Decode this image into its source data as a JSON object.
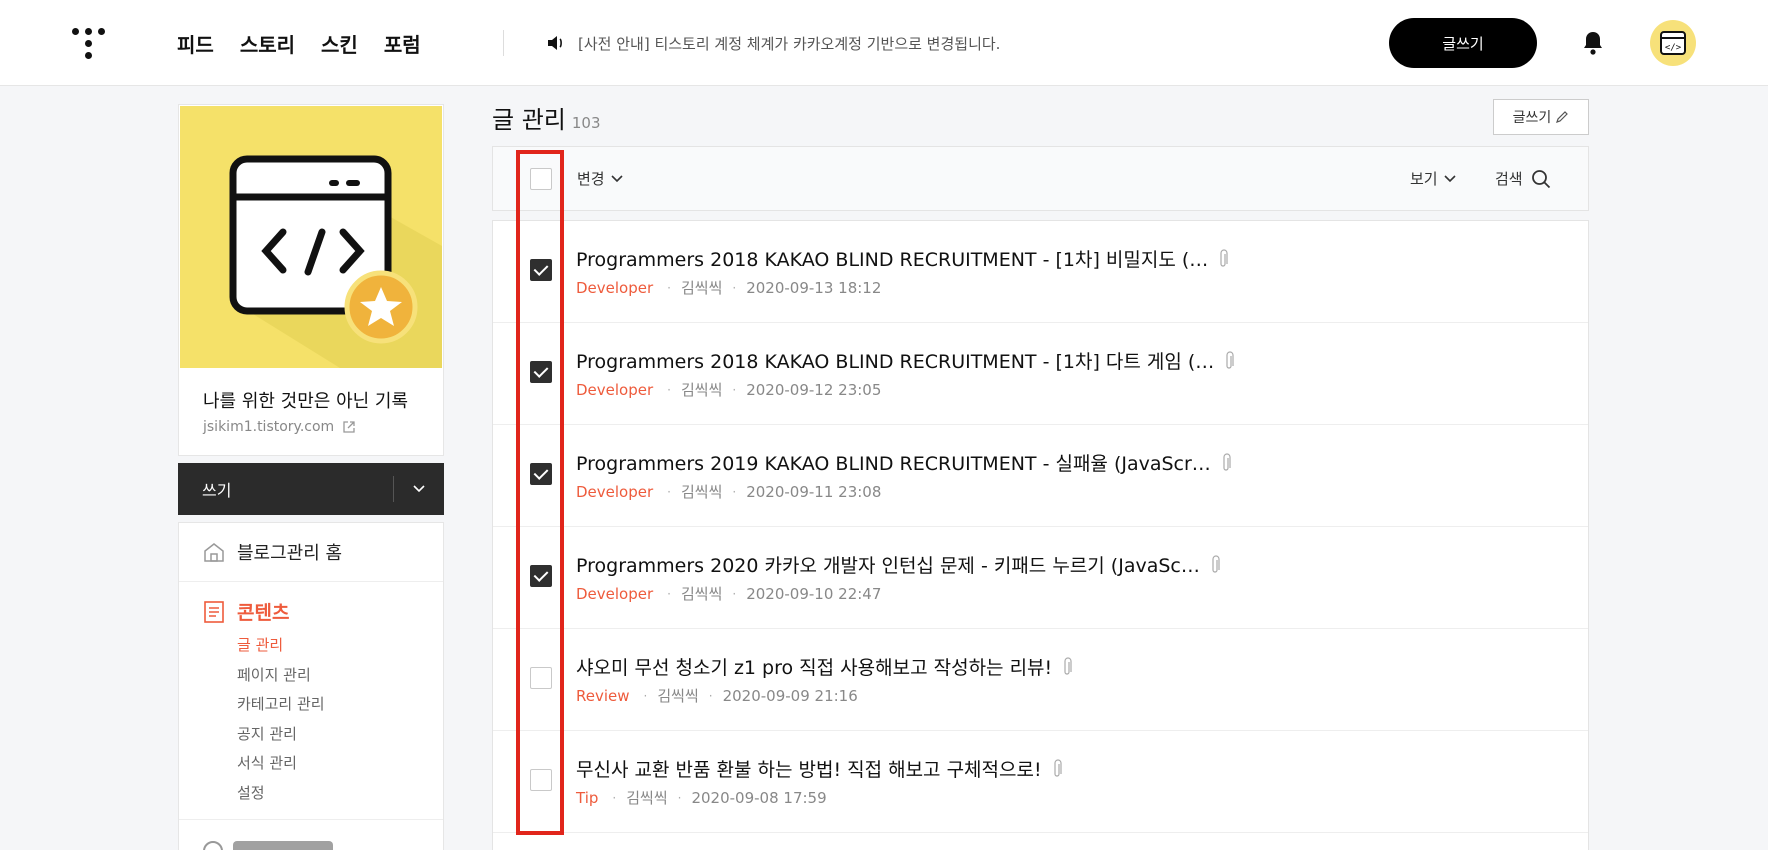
{
  "header": {
    "nav": [
      "피드",
      "스토리",
      "스킨",
      "포럼"
    ],
    "notice": "[사전 안내] 티스토리 계정 체계가 카카오계정 기반으로 변경됩니다.",
    "write_button": "글쓰기"
  },
  "sidebar": {
    "blog_name": "나를 위한 것만은 아닌 기록",
    "blog_url": "jsikim1.tistory.com",
    "write_label": "쓰기",
    "home_label": "블로그관리 홈",
    "content_label": "콘텐츠",
    "submenu": [
      "글 관리",
      "페이지 관리",
      "카테고리 관리",
      "공지 관리",
      "서식 관리",
      "설정"
    ]
  },
  "main": {
    "title": "글 관리",
    "count": "103",
    "write_small": "글쓰기",
    "toolbar": {
      "change": "변경",
      "view": "보기",
      "search": "검색"
    },
    "posts": [
      {
        "title": "Programmers 2018 KAKAO BLIND RECRUITMENT - [1차] 비밀지도 (…",
        "category": "Developer",
        "author": "김씩씩",
        "date": "2020-09-13 18:12",
        "checked": true
      },
      {
        "title": "Programmers 2018 KAKAO BLIND RECRUITMENT - [1차] 다트 게임 (…",
        "category": "Developer",
        "author": "김씩씩",
        "date": "2020-09-12 23:05",
        "checked": true
      },
      {
        "title": "Programmers 2019 KAKAO BLIND RECRUITMENT - 실패율 (JavaScr…",
        "category": "Developer",
        "author": "김씩씩",
        "date": "2020-09-11 23:08",
        "checked": true
      },
      {
        "title": "Programmers 2020 카카오 개발자 인턴십 문제 - 키패드 누르기 (JavaSc…",
        "category": "Developer",
        "author": "김씩씩",
        "date": "2020-09-10 22:47",
        "checked": true
      },
      {
        "title": "샤오미 무선 청소기 z1 pro 직접 사용해보고 작성하는 리뷰!",
        "category": "Review",
        "author": "김씩씩",
        "date": "2020-09-09 21:16",
        "checked": false
      },
      {
        "title": "무신사 교환 반품 환불 하는 방법! 직접 해보고 구체적으로!",
        "category": "Tip",
        "author": "김씩씩",
        "date": "2020-09-08 17:59",
        "checked": false
      }
    ]
  },
  "colors": {
    "accent": "#ee5b3c",
    "highlight": "#e1251b",
    "dark": "#2b2b2b"
  }
}
